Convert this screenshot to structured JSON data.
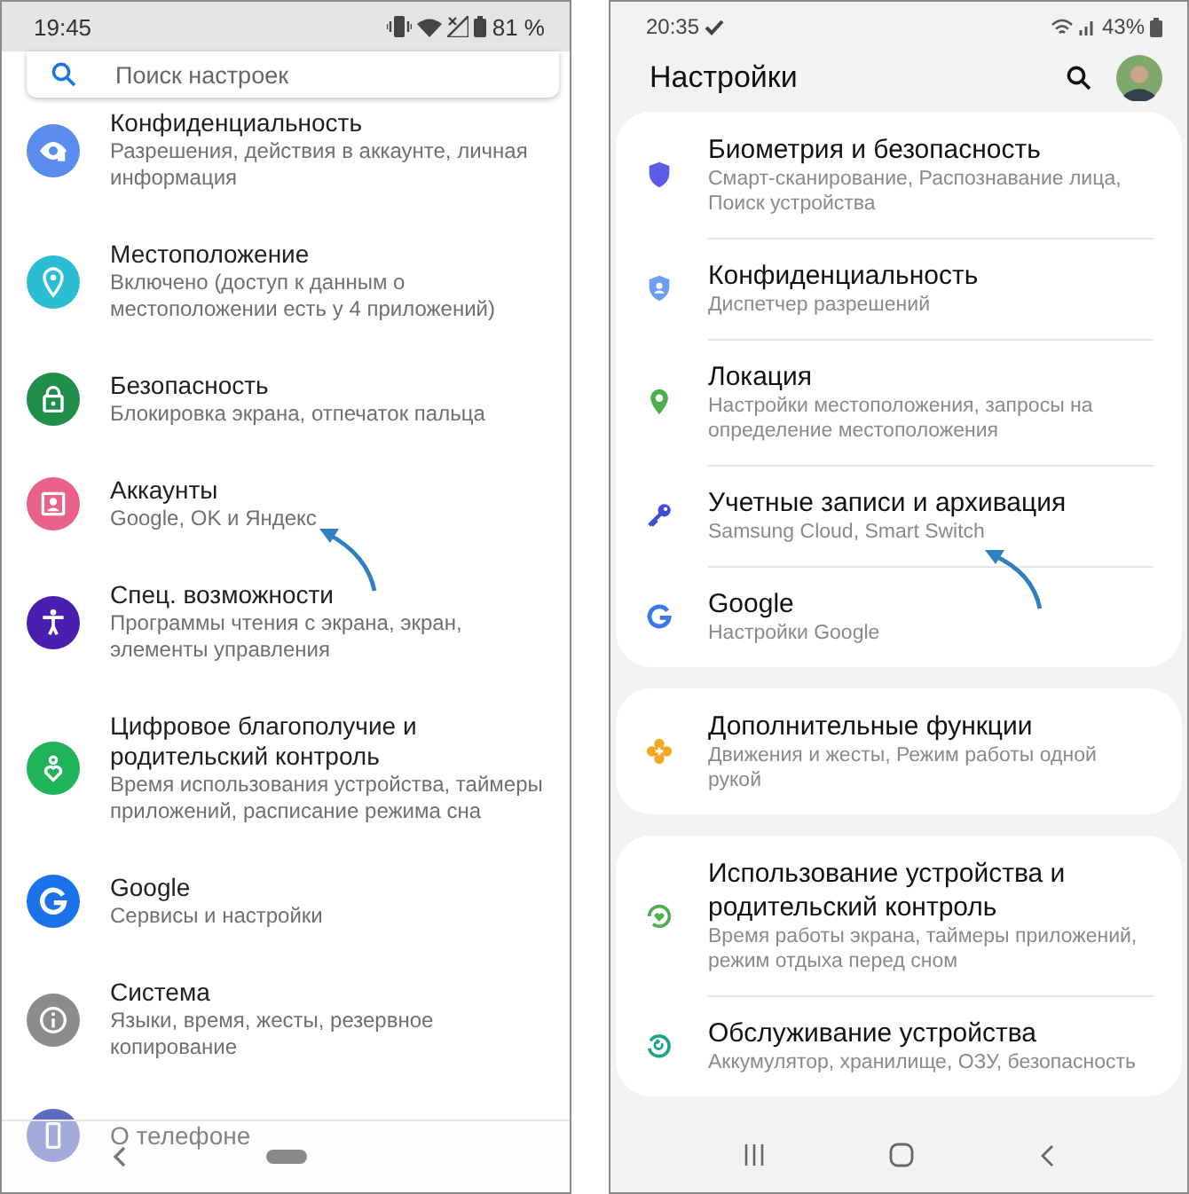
{
  "left_phone": {
    "status_bar": {
      "time": "19:45",
      "battery": "81 %"
    },
    "search": {
      "placeholder": "Поиск настроек"
    },
    "items": [
      {
        "title": "Конфиденциальность",
        "subtitle": "Разрешения, действия в аккаунте, личная информация",
        "color": "#5b8def"
      },
      {
        "title": "Местоположение",
        "subtitle": "Включено (доступ к данным о местоположении есть у 4 приложений)",
        "color": "#2bbdd4"
      },
      {
        "title": "Безопасность",
        "subtitle": "Блокировка экрана, отпечаток пальца",
        "color": "#1e8e4a"
      },
      {
        "title": "Аккаунты",
        "subtitle": "Google, OK и Яндекс",
        "color": "#e8628a"
      },
      {
        "title": "Спец. возможности",
        "subtitle": "Программы чтения с экрана, экран, элементы управления",
        "color": "#4a1fb0"
      },
      {
        "title": "Цифровое благополучие и родительский контроль",
        "subtitle": "Время использования устройства, таймеры приложений, расписание режима сна",
        "color": "#1fb35a"
      },
      {
        "title": "Google",
        "subtitle": "Сервисы и настройки",
        "color": "#1a73e8"
      },
      {
        "title": "Система",
        "subtitle": "Языки, время, жесты, резервное копирование",
        "color": "#8c8c8c"
      },
      {
        "title": "О телефоне",
        "color": "#5c6bc0"
      }
    ]
  },
  "right_phone": {
    "status_bar": {
      "time": "20:35",
      "battery": "43%"
    },
    "title": "Настройки",
    "cards": [
      {
        "items": [
          {
            "title": "Биометрия и безопасность",
            "subtitle": "Смарт-сканирование, Распознавание лица, Поиск устройства",
            "color": "#5b5ce6"
          },
          {
            "title": "Конфиденциальность",
            "subtitle": "Диспетчер разрешений",
            "color": "#6f9ef0"
          },
          {
            "title": "Локация",
            "subtitle": "Настройки местоположения, запросы на определение местоположения",
            "color": "#4caf50"
          },
          {
            "title": "Учетные записи и архивация",
            "subtitle": "Samsung Cloud, Smart Switch",
            "color": "#3d4fd1"
          },
          {
            "title": "Google",
            "subtitle": "Настройки Google",
            "color": "#3b78e7"
          }
        ]
      },
      {
        "items": [
          {
            "title": "Дополнительные функции",
            "subtitle": "Движения и жесты, Режим работы одной рукой",
            "color": "#f5a623"
          }
        ]
      },
      {
        "items": [
          {
            "title": "Использование устройства и родительский контроль",
            "subtitle": "Время работы экрана, таймеры приложений, режим отдыха перед сном",
            "color": "#4caf50"
          },
          {
            "title": "Обслуживание устройства",
            "subtitle": "Аккумулятор, хранилище, ОЗУ, безопасность",
            "color": "#1aa58a"
          }
        ]
      }
    ]
  }
}
